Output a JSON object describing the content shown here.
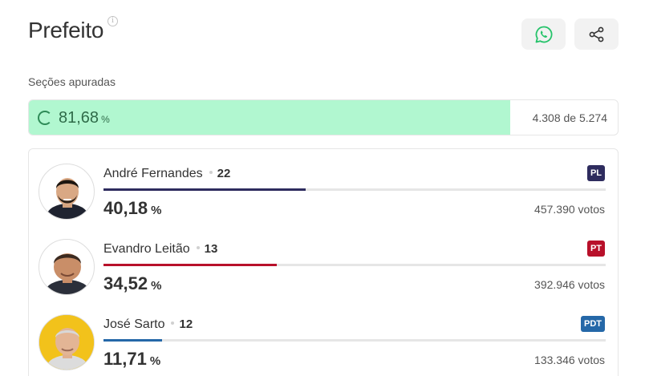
{
  "header": {
    "title": "Prefeito",
    "info_icon": "info-icon",
    "whatsapp_icon": "whatsapp-icon",
    "share_icon": "share-icon"
  },
  "apuracao": {
    "label": "Seções apuradas",
    "percent": "81,68",
    "percent_unit": "%",
    "percent_value": 81.68,
    "count_text": "4.308 de 5.274",
    "fill_color": "#b1f7d0"
  },
  "candidates": [
    {
      "name": "André Fernandes",
      "number": "22",
      "party": "PL",
      "party_color": "#2e2c5e",
      "bar_color": "#2e2c5e",
      "percent": "40,18",
      "percent_unit": "%",
      "percent_value": 40.18,
      "votes": "457.390 votos"
    },
    {
      "name": "Evandro Leitão",
      "number": "13",
      "party": "PT",
      "party_color": "#b8102a",
      "bar_color": "#b8102a",
      "percent": "34,52",
      "percent_unit": "%",
      "percent_value": 34.52,
      "votes": "392.946 votos"
    },
    {
      "name": "José Sarto",
      "number": "12",
      "party": "PDT",
      "party_color": "#2568a8",
      "bar_color": "#2568a8",
      "percent": "11,71",
      "percent_unit": "%",
      "percent_value": 11.71,
      "votes": "133.346 votos"
    }
  ]
}
